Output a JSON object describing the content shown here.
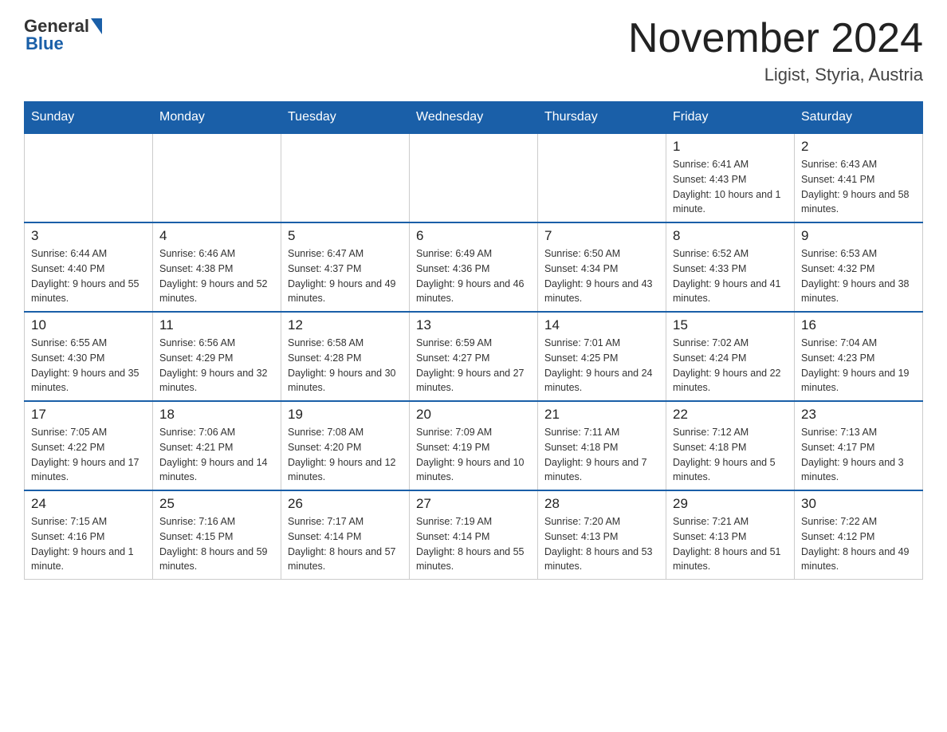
{
  "header": {
    "logo_general": "General",
    "logo_blue": "Blue",
    "month_title": "November 2024",
    "location": "Ligist, Styria, Austria"
  },
  "weekdays": [
    "Sunday",
    "Monday",
    "Tuesday",
    "Wednesday",
    "Thursday",
    "Friday",
    "Saturday"
  ],
  "weeks": [
    [
      {
        "day": "",
        "info": ""
      },
      {
        "day": "",
        "info": ""
      },
      {
        "day": "",
        "info": ""
      },
      {
        "day": "",
        "info": ""
      },
      {
        "day": "",
        "info": ""
      },
      {
        "day": "1",
        "info": "Sunrise: 6:41 AM\nSunset: 4:43 PM\nDaylight: 10 hours and 1 minute."
      },
      {
        "day": "2",
        "info": "Sunrise: 6:43 AM\nSunset: 4:41 PM\nDaylight: 9 hours and 58 minutes."
      }
    ],
    [
      {
        "day": "3",
        "info": "Sunrise: 6:44 AM\nSunset: 4:40 PM\nDaylight: 9 hours and 55 minutes."
      },
      {
        "day": "4",
        "info": "Sunrise: 6:46 AM\nSunset: 4:38 PM\nDaylight: 9 hours and 52 minutes."
      },
      {
        "day": "5",
        "info": "Sunrise: 6:47 AM\nSunset: 4:37 PM\nDaylight: 9 hours and 49 minutes."
      },
      {
        "day": "6",
        "info": "Sunrise: 6:49 AM\nSunset: 4:36 PM\nDaylight: 9 hours and 46 minutes."
      },
      {
        "day": "7",
        "info": "Sunrise: 6:50 AM\nSunset: 4:34 PM\nDaylight: 9 hours and 43 minutes."
      },
      {
        "day": "8",
        "info": "Sunrise: 6:52 AM\nSunset: 4:33 PM\nDaylight: 9 hours and 41 minutes."
      },
      {
        "day": "9",
        "info": "Sunrise: 6:53 AM\nSunset: 4:32 PM\nDaylight: 9 hours and 38 minutes."
      }
    ],
    [
      {
        "day": "10",
        "info": "Sunrise: 6:55 AM\nSunset: 4:30 PM\nDaylight: 9 hours and 35 minutes."
      },
      {
        "day": "11",
        "info": "Sunrise: 6:56 AM\nSunset: 4:29 PM\nDaylight: 9 hours and 32 minutes."
      },
      {
        "day": "12",
        "info": "Sunrise: 6:58 AM\nSunset: 4:28 PM\nDaylight: 9 hours and 30 minutes."
      },
      {
        "day": "13",
        "info": "Sunrise: 6:59 AM\nSunset: 4:27 PM\nDaylight: 9 hours and 27 minutes."
      },
      {
        "day": "14",
        "info": "Sunrise: 7:01 AM\nSunset: 4:25 PM\nDaylight: 9 hours and 24 minutes."
      },
      {
        "day": "15",
        "info": "Sunrise: 7:02 AM\nSunset: 4:24 PM\nDaylight: 9 hours and 22 minutes."
      },
      {
        "day": "16",
        "info": "Sunrise: 7:04 AM\nSunset: 4:23 PM\nDaylight: 9 hours and 19 minutes."
      }
    ],
    [
      {
        "day": "17",
        "info": "Sunrise: 7:05 AM\nSunset: 4:22 PM\nDaylight: 9 hours and 17 minutes."
      },
      {
        "day": "18",
        "info": "Sunrise: 7:06 AM\nSunset: 4:21 PM\nDaylight: 9 hours and 14 minutes."
      },
      {
        "day": "19",
        "info": "Sunrise: 7:08 AM\nSunset: 4:20 PM\nDaylight: 9 hours and 12 minutes."
      },
      {
        "day": "20",
        "info": "Sunrise: 7:09 AM\nSunset: 4:19 PM\nDaylight: 9 hours and 10 minutes."
      },
      {
        "day": "21",
        "info": "Sunrise: 7:11 AM\nSunset: 4:18 PM\nDaylight: 9 hours and 7 minutes."
      },
      {
        "day": "22",
        "info": "Sunrise: 7:12 AM\nSunset: 4:18 PM\nDaylight: 9 hours and 5 minutes."
      },
      {
        "day": "23",
        "info": "Sunrise: 7:13 AM\nSunset: 4:17 PM\nDaylight: 9 hours and 3 minutes."
      }
    ],
    [
      {
        "day": "24",
        "info": "Sunrise: 7:15 AM\nSunset: 4:16 PM\nDaylight: 9 hours and 1 minute."
      },
      {
        "day": "25",
        "info": "Sunrise: 7:16 AM\nSunset: 4:15 PM\nDaylight: 8 hours and 59 minutes."
      },
      {
        "day": "26",
        "info": "Sunrise: 7:17 AM\nSunset: 4:14 PM\nDaylight: 8 hours and 57 minutes."
      },
      {
        "day": "27",
        "info": "Sunrise: 7:19 AM\nSunset: 4:14 PM\nDaylight: 8 hours and 55 minutes."
      },
      {
        "day": "28",
        "info": "Sunrise: 7:20 AM\nSunset: 4:13 PM\nDaylight: 8 hours and 53 minutes."
      },
      {
        "day": "29",
        "info": "Sunrise: 7:21 AM\nSunset: 4:13 PM\nDaylight: 8 hours and 51 minutes."
      },
      {
        "day": "30",
        "info": "Sunrise: 7:22 AM\nSunset: 4:12 PM\nDaylight: 8 hours and 49 minutes."
      }
    ]
  ]
}
